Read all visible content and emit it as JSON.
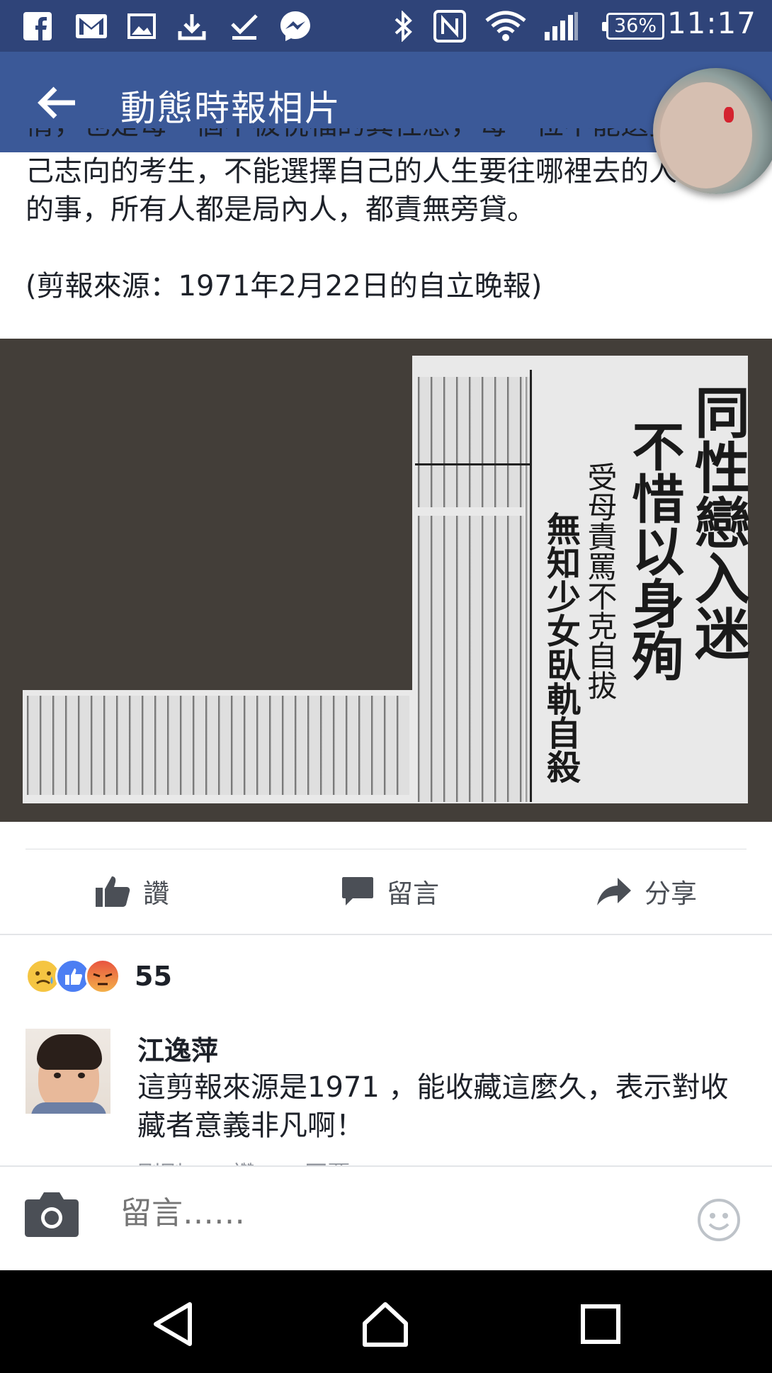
{
  "status_bar": {
    "time": "11:17",
    "battery": "36%",
    "icons": [
      "facebook-icon",
      "gmail-icon",
      "gallery-icon",
      "download-icon",
      "check-icon",
      "messenger-icon",
      "bluetooth-icon",
      "nfc-icon",
      "wifi-icon",
      "signal-icon"
    ]
  },
  "app_bar": {
    "title": "動態時報相片"
  },
  "post": {
    "clipped_line": "情，也是每一個不被祝福的異性戀，每一位不能選擇自",
    "lines": [
      "己志向的考生，不能選擇自己的人生要往哪裡去的人",
      "的事，所有人都是局內人，都責無旁貸。",
      "",
      "(剪報來源：1971年2月22日的自立晚報)"
    ]
  },
  "clipping": {
    "headline_1": "同性戀入迷",
    "headline_2": "不惜以身殉",
    "sub_headline": "受母責罵不克自拔",
    "headline_3": "無知少女臥軌自殺"
  },
  "actions": {
    "like": "讚",
    "comment": "留言",
    "share": "分享"
  },
  "reactions": {
    "count": "55",
    "types": [
      "sad-reaction",
      "like-reaction",
      "angry-reaction"
    ]
  },
  "comment": {
    "author": "江逸萍",
    "text": "這剪報來源是1971 ，能收藏這麼久，表示對收藏者意義非凡啊！",
    "meta": [
      "剛剛",
      "讚",
      "回覆"
    ]
  },
  "composer": {
    "placeholder": "留言……"
  }
}
